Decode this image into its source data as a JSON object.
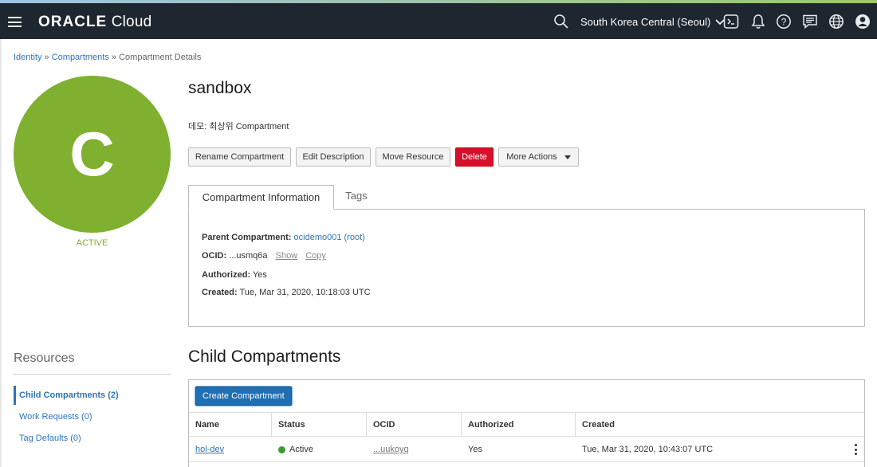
{
  "header": {
    "logo_brand": "ORACLE",
    "logo_product": "Cloud",
    "region": "South Korea Central (Seoul)"
  },
  "breadcrumb": {
    "items": [
      "Identity",
      "Compartments"
    ],
    "separator": "»",
    "current": "Compartment Details"
  },
  "avatar": {
    "letter": "C",
    "status": "ACTIVE",
    "color": "#7fb030"
  },
  "resources": {
    "title": "Resources",
    "items": [
      {
        "label": "Child Compartments (2)",
        "active": true
      },
      {
        "label": "Work Requests (0)",
        "active": false
      },
      {
        "label": "Tag Defaults (0)",
        "active": false
      }
    ]
  },
  "compartment": {
    "name": "sandbox",
    "description": "데모: 최상위 Compartment"
  },
  "actions": {
    "rename": "Rename Compartment",
    "edit_description": "Edit Description",
    "move_resource": "Move Resource",
    "delete": "Delete",
    "more_actions": "More Actions"
  },
  "tabs": {
    "info": "Compartment Information",
    "tags": "Tags"
  },
  "info": {
    "parent_label": "Parent Compartment:",
    "parent_value": "ocidemo001 (root)",
    "ocid_label": "OCID:",
    "ocid_value": "...usmq6a",
    "show": "Show",
    "copy": "Copy",
    "authorized_label": "Authorized:",
    "authorized_value": "Yes",
    "created_label": "Created:",
    "created_value": "Tue, Mar 31, 2020, 10:18:03 UTC"
  },
  "child": {
    "title": "Child Compartments",
    "create_button": "Create Compartment",
    "columns": [
      "Name",
      "Status",
      "OCID",
      "Authorized",
      "Created"
    ],
    "rows": [
      {
        "name": "hol-dev",
        "status": "Active",
        "ocid": "...uukoyq",
        "authorized": "Yes",
        "created": "Tue, Mar 31, 2020, 10:43:07 UTC"
      }
    ]
  },
  "colors": {
    "header_bg": "#1e2630",
    "link": "#2e75b6",
    "delete": "#d50f2c",
    "primary": "#1f6fb2",
    "active_green": "#3d9b35"
  }
}
